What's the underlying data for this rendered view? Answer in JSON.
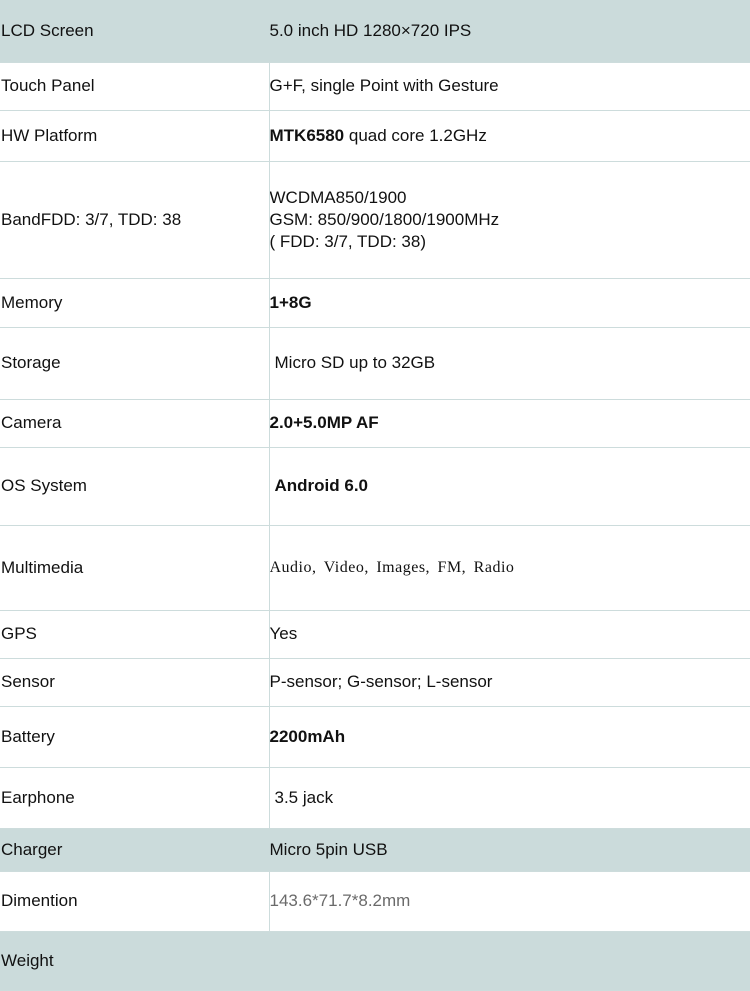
{
  "specs": [
    {
      "label": "LCD Screen",
      "value": "5.0 inch HD 1280×720  IPS"
    },
    {
      "label": "Touch Panel",
      "value": "G+F, single Point with Gesture"
    },
    {
      "label": "HW Platform",
      "value_bold": "MTK6580",
      "value_rest": " quad core 1.2GHz"
    },
    {
      "label": "BandFDD: 3/7, TDD: 38",
      "value_lines": [
        "WCDMA850/1900",
        "GSM: 850/900/1800/1900MHz",
        "( FDD: 3/7, TDD: 38)"
      ]
    },
    {
      "label": "Memory",
      "value": "1+8G"
    },
    {
      "label": "Storage",
      "value": "Micro SD up to 32GB"
    },
    {
      "label": "Camera",
      "value": "2.0+5.0MP AF"
    },
    {
      "label": "OS System",
      "value": "Android 6.0"
    },
    {
      "label": "Multimedia",
      "value": "Audio, Video, Images, FM, Radio"
    },
    {
      "label": "GPS",
      "value": "Yes"
    },
    {
      "label": "Sensor",
      "value": "P-sensor; G-sensor; L-sensor"
    },
    {
      "label": "Battery",
      "value": "2200mAh"
    },
    {
      "label": "Earphone",
      "value": "3.5 jack"
    },
    {
      "label": "Charger",
      "value": "Micro 5pin USB"
    },
    {
      "label": "Dimention",
      "value": "143.6*71.7*8.2mm"
    },
    {
      "label": "Weight",
      "value": ""
    }
  ],
  "colors": {
    "row_shade": "#cbdbdb",
    "grid_line": "#cddcdc",
    "text": "#111111",
    "muted_text": "#6a6a6a"
  }
}
